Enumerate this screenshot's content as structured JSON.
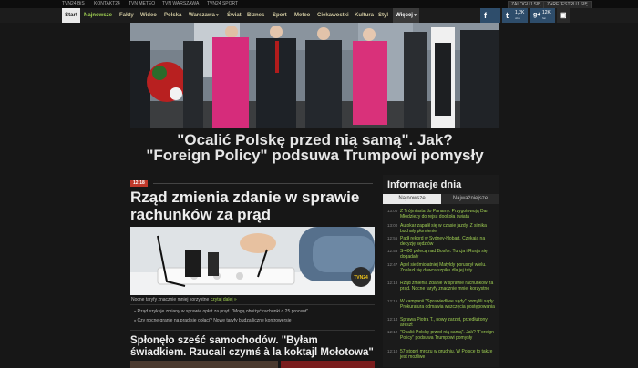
{
  "top_links": [
    "TVN24 BiS",
    "KONTAKT24",
    "TVN METEO",
    "TVN WARSZAWA",
    "TVN24 SPORT"
  ],
  "top_buttons": [
    "ZALOGUJ SIĘ",
    "ZAREJESTRUJ SIĘ"
  ],
  "nav": {
    "start": "Start",
    "items": [
      "Najnowsze",
      "Fakty",
      "Wideo",
      "Polska",
      "Warszawa",
      "Świat",
      "Biznes",
      "Sport",
      "Meteo",
      "Ciekawostki",
      "Kultura i Styl",
      "Więcej"
    ]
  },
  "social": [
    {
      "icon": "f",
      "count": "",
      "label": ""
    },
    {
      "icon": "t",
      "count": "1,2K",
      "label": "obs."
    },
    {
      "icon": "g+",
      "count": "12K",
      "label": "fan"
    }
  ],
  "hero": {
    "headline_line1": "\"Ocalić Polskę przed nią samą\". Jak?",
    "headline_line2": "\"Foreign Policy\" podsuwa Trumpowi pomysły"
  },
  "main_story": {
    "time": "12:18",
    "title": "Rząd zmienia zdanie w sprawie rachunków za prąd",
    "lead": "Nocne taryfy znacznie mniej korzystne",
    "lead_link": "czytaj dalej »",
    "image_logo": "TVN24",
    "bullets": [
      "Rząd szykuje zmiany w sprawie opłat za prąd. \"Mogą obniżyć rachunki o 25 procent\"",
      "Czy nocne granie na prąd się opłaci? Nowe taryfy budzą liczne kontrowersje"
    ]
  },
  "second_story": {
    "title": "Spłonęło sześć samochodów. \"Byłam świadkiem. Rzucali czymś à la koktajl Mołotowa\""
  },
  "sidebar": {
    "title": "Informacje dnia",
    "tabs": [
      "Najnowsze",
      "Najważniejsze"
    ],
    "items": [
      {
        "time": "13:00",
        "text": "Z Trójmiasta do Panamy. Przygotowują Dar Młodzieży do rejsu dookoła świata"
      },
      {
        "time": "13:00",
        "text": "Autokar zapalił się w czasie jazdy. Z silnika buchały płomienie"
      },
      {
        "time": "12:56",
        "text": "Padł rekord w Sydney-Hobart. Czekają na decyzję sędziów"
      },
      {
        "time": "12:53",
        "text": "S-400 polecą nad Bosfor. Turcja i Rosja się dogadały"
      },
      {
        "time": "12:47",
        "text": "Apel siedmiolatniej Matyldy poruszył wielu. Znalazł się dawca szpiku dla jej taty"
      },
      {
        "time": "12:18",
        "text": "Rząd zmienia zdanie w sprawie rachunków za prąd. Nocne taryfy znacznie mniej korzystne"
      },
      {
        "time": "12:16",
        "text": "W kampanii \"Sprawiedliwe sądy\" pomylili sądy. Prokuratura odmawia wszczęcia postępowania"
      },
      {
        "time": "12:14",
        "text": "Sprawa Piotra T., nowy zarzut, przedłużony areszt"
      },
      {
        "time": "12:12",
        "text": "\"Ocalić Polskę przed nią samą\". Jak? \"Foreign Policy\" podsuwa Trumpowi pomysły"
      },
      {
        "time": "12:10",
        "text": "57 stopni mrozu w grudniu. W Polsce to także jest możliwe"
      }
    ]
  }
}
